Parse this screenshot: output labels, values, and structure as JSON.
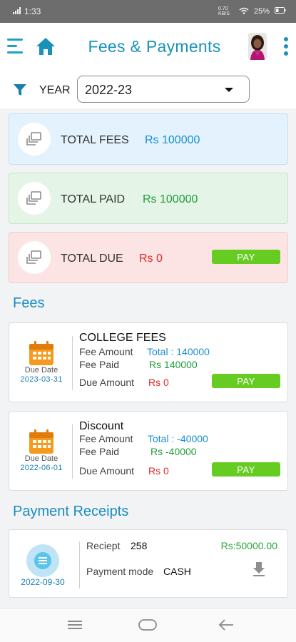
{
  "status_bar": {
    "time": "1:33",
    "network_speed": "0.70 KB/S",
    "battery": "25%",
    "icons": [
      "signal-icon",
      "wifi-icon",
      "battery-icon"
    ]
  },
  "header": {
    "title": "Fees & Payments",
    "icons": [
      "menu-icon",
      "home-icon",
      "avatar",
      "more-vert-icon"
    ]
  },
  "filter": {
    "label": "YEAR",
    "selected": "2022-23",
    "icon": "filter-icon"
  },
  "summary": {
    "total_fees": {
      "label": "TOTAL FEES",
      "value": "Rs 100000",
      "color": "#1a8fd6"
    },
    "total_paid": {
      "label": "TOTAL PAID",
      "value": "Rs 100000",
      "color": "#1e9e3a"
    },
    "total_due": {
      "label": "TOTAL DUE",
      "value": "Rs 0",
      "color": "#e02a2a",
      "pay_label": "PAY"
    }
  },
  "fees_section": {
    "heading": "Fees",
    "items": [
      {
        "name": "COLLEGE FEES",
        "due_label": "Due Date",
        "due_date": "2023-03-31",
        "amount_label": "Fee Amount",
        "amount_value": "Total : 140000",
        "paid_label": "Fee Paid",
        "paid_value": "Rs 140000",
        "due_amount_label": "Due Amount",
        "due_amount_value": "Rs 0",
        "pay_label": "PAY"
      },
      {
        "name": "Discount",
        "due_label": "Due Date",
        "due_date": "2022-06-01",
        "amount_label": "Fee Amount",
        "amount_value": "Total : -40000",
        "paid_label": "Fee Paid",
        "paid_value": "Rs -40000",
        "due_amount_label": "Due Amount",
        "due_amount_value": "Rs 0",
        "pay_label": "PAY"
      }
    ]
  },
  "receipts_section": {
    "heading": "Payment Receipts",
    "items": [
      {
        "receipt_label": "Reciept",
        "receipt_no": "258",
        "mode_label": "Payment mode",
        "mode_value": "CASH",
        "amount": "Rs:50000.00",
        "date": "2022-09-30"
      }
    ]
  },
  "colors": {
    "accent": "#1a92b8",
    "pay_button": "#66cc22",
    "fee_blue": "#1a8fd6",
    "paid_green": "#1e9e3a",
    "due_red": "#e02a2a"
  }
}
